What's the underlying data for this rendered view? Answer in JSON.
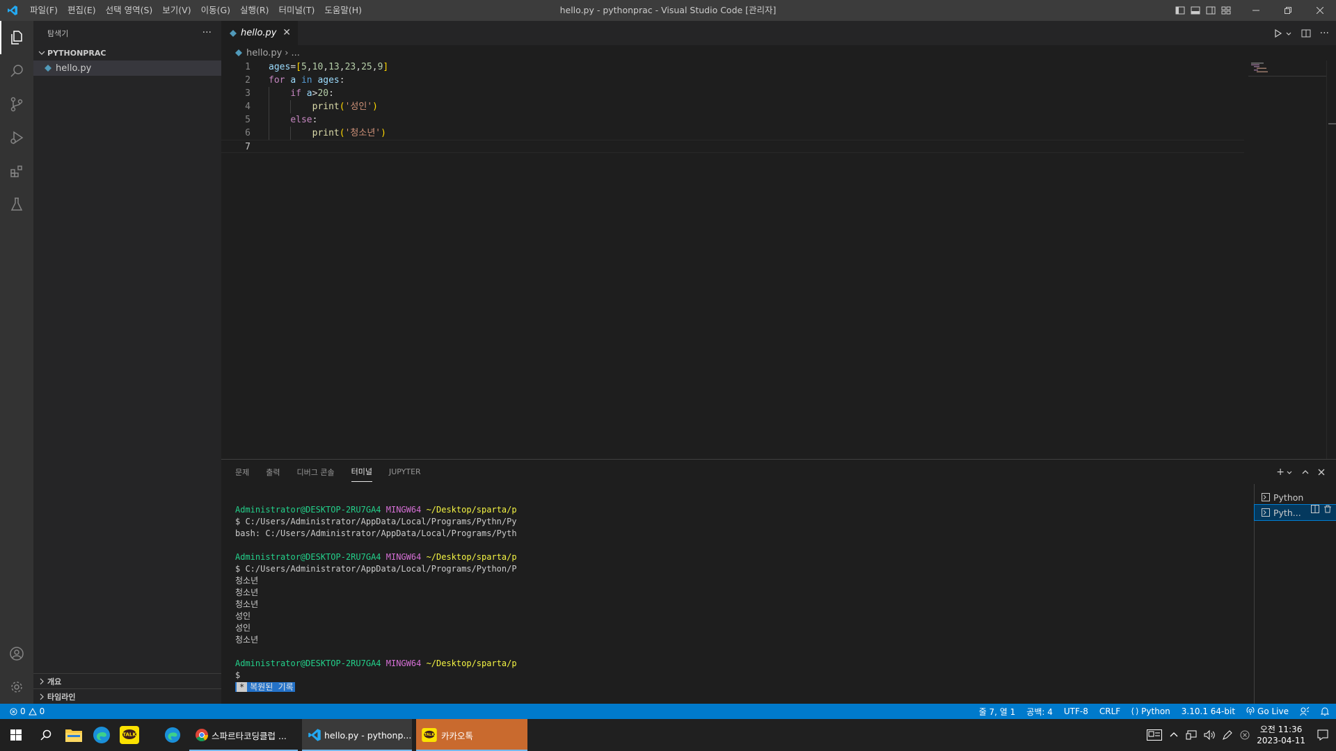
{
  "titlebar": {
    "menu": [
      "파일(F)",
      "편집(E)",
      "선택 영역(S)",
      "보기(V)",
      "이동(G)",
      "실행(R)",
      "터미널(T)",
      "도움말(H)"
    ],
    "title": "hello.py - pythonprac - Visual Studio Code [관리자]"
  },
  "sidebar": {
    "header": "탐색기",
    "more": "···",
    "folder": "PYTHONPRAC",
    "file": "hello.py",
    "outline": "개요",
    "timeline": "타임라인"
  },
  "editor": {
    "tab_label": "hello.py",
    "breadcrumb_file": "hello.py",
    "breadcrumb_rest": "...",
    "line_numbers": [
      "1",
      "2",
      "3",
      "4",
      "5",
      "6",
      "7"
    ],
    "strings": {
      "adult": "'성인'",
      "teen": "'청소년'"
    }
  },
  "panel": {
    "tabs": [
      "문제",
      "출력",
      "디버그 콘솔",
      "터미널",
      "JUPYTER"
    ],
    "active_tab": "터미널",
    "terminal": {
      "user_host": "Administrator@DESKTOP-2RU7GA4",
      "shell": "MINGW64",
      "path": "~/Desktop/sparta/p",
      "cmd1": "$ C:/Users/Administrator/AppData/Local/Programs/Pythn/Py",
      "err1": "bash: C:/Users/Administrator/AppData/Local/Programs/Pyth",
      "cmd2": "$ C:/Users/Administrator/AppData/Local/Programs/Python/P",
      "output": [
        "청소년",
        "청소년",
        "청소년",
        "성인",
        "성인",
        "청소년"
      ],
      "prompt": "$",
      "restored_star": "*",
      "restored": "복원된 기록"
    },
    "terminal_list": [
      "Python",
      "Pyth..."
    ]
  },
  "statusbar": {
    "errors": "0",
    "warnings": "0",
    "position": "줄 7, 열 1",
    "spaces": "공백: 4",
    "encoding": "UTF-8",
    "eol": "CRLF",
    "language": "Python",
    "interpreter": "3.10.1 64-bit",
    "golive": "Go Live"
  },
  "taskbar": {
    "chrome_label": "스파르타코딩클럽 ...",
    "vscode_label": "hello.py - pythonp...",
    "kakao_label": "카카오톡",
    "time": "오전 11:36",
    "date": "2023-04-11"
  },
  "colors": {
    "accent": "#007acc",
    "activity_bar": "#333333",
    "sidebar": "#252526",
    "editor": "#1e1e1e"
  }
}
